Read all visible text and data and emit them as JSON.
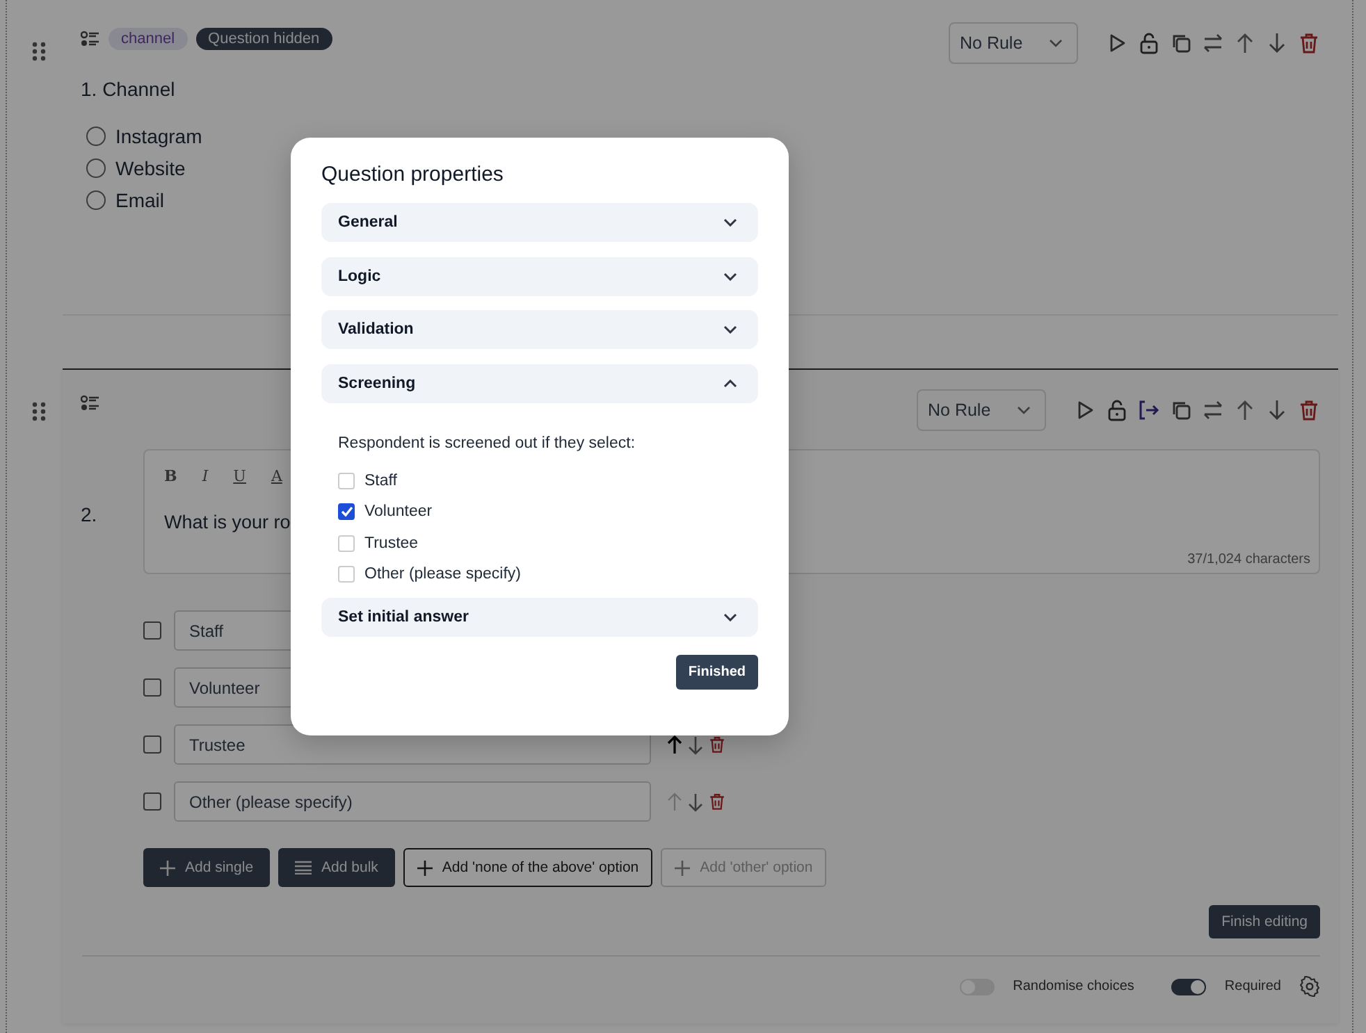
{
  "questions": [
    {
      "number": "1.",
      "tags": [
        {
          "label": "channel",
          "kind": "tag"
        },
        {
          "label": "Question hidden",
          "kind": "status"
        }
      ],
      "title": "Channel",
      "rule": "No Rule",
      "screening_active": false,
      "options": [
        {
          "label": "Instagram",
          "selected": false
        },
        {
          "label": "Website",
          "selected": false
        },
        {
          "label": "Email",
          "selected": false
        }
      ]
    },
    {
      "number": "2.",
      "rule": "No Rule",
      "screening_active": true,
      "format_buttons": [
        "B",
        "I",
        "U",
        "A"
      ],
      "text": "What is your ro",
      "counter": "37/1,024 characters",
      "choices": [
        {
          "value": "Staff",
          "checked": false,
          "actions_visible": false
        },
        {
          "value": "Volunteer",
          "checked": false,
          "actions_visible": false
        },
        {
          "value": "Trustee",
          "checked": false,
          "actions_visible": true,
          "up_disabled": false
        },
        {
          "value": "Other (please specify)",
          "checked": false,
          "actions_visible": true,
          "up_disabled": true
        }
      ],
      "add_buttons": [
        {
          "label": "Add single",
          "kind": "single",
          "disabled": false
        },
        {
          "label": "Add bulk",
          "kind": "bulk",
          "disabled": false
        },
        {
          "label": "Add 'none of the above' option",
          "kind": "outline",
          "disabled": false
        },
        {
          "label": "Add 'other' option",
          "kind": "outline",
          "disabled": true
        }
      ],
      "finish_button": "Finish editing",
      "toggles": [
        {
          "label": "Randomise choices",
          "on": false
        },
        {
          "label": "Required",
          "on": true
        }
      ]
    }
  ],
  "dialog": {
    "title": "Question properties",
    "sections": [
      {
        "label": "General",
        "expanded": false
      },
      {
        "label": "Logic",
        "expanded": false
      },
      {
        "label": "Validation",
        "expanded": false
      },
      {
        "label": "Screening",
        "expanded": true
      },
      {
        "label": "Set initial answer",
        "expanded": false
      }
    ],
    "screening": {
      "prompt": "Respondent is screened out if they select:",
      "choices": [
        {
          "label": "Staff",
          "checked": false
        },
        {
          "label": "Volunteer",
          "checked": true
        },
        {
          "label": "Trustee",
          "checked": false
        },
        {
          "label": "Other (please specify)",
          "checked": false
        }
      ]
    },
    "button": "Finished"
  }
}
